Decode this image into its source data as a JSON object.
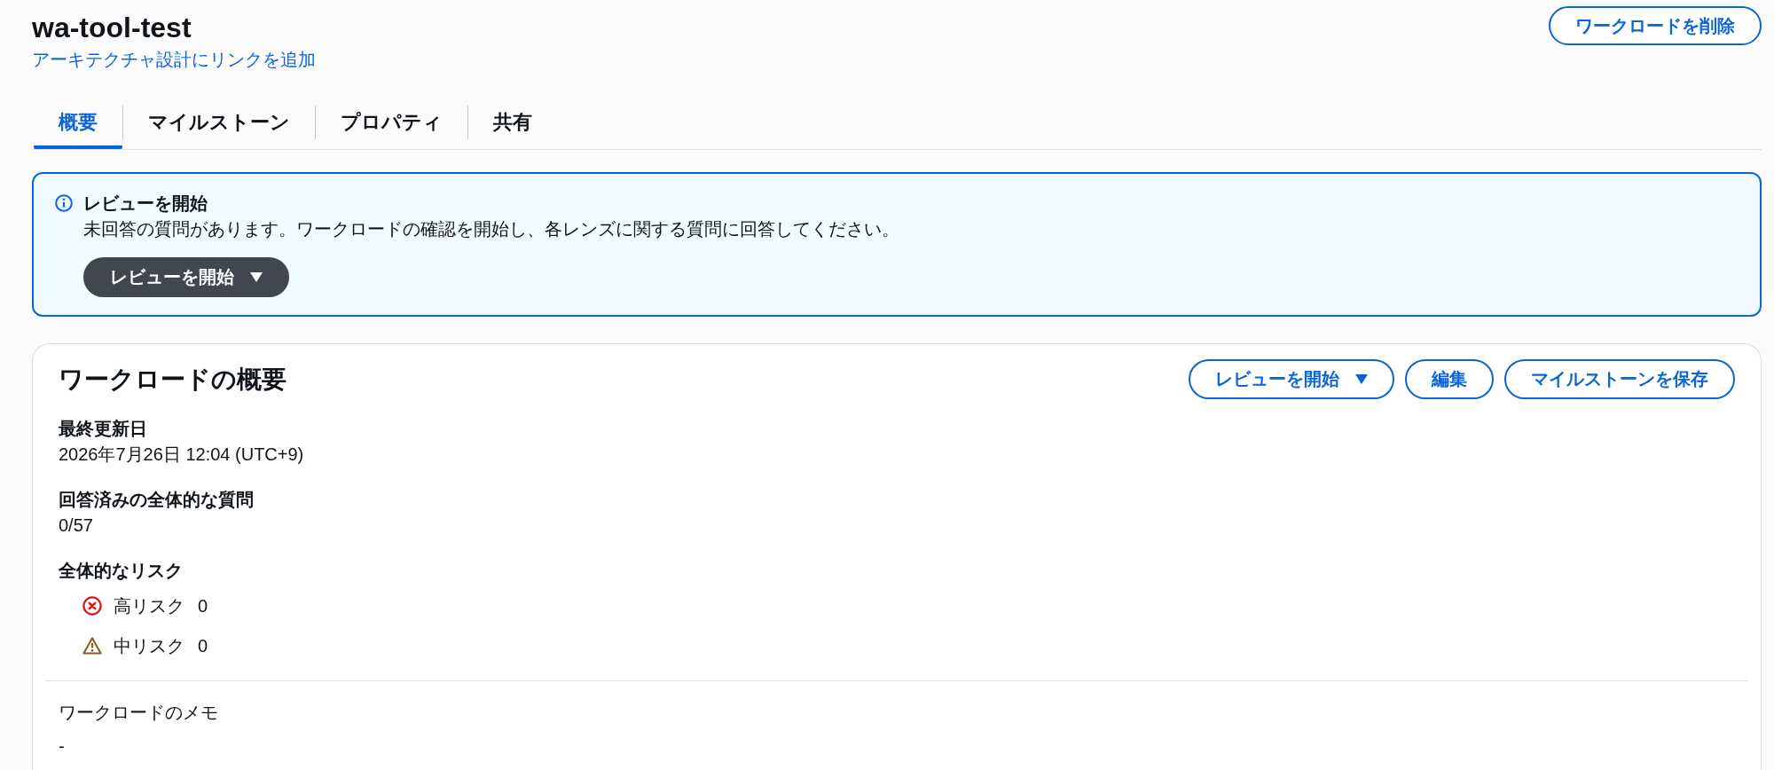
{
  "header": {
    "title": "wa-tool-test",
    "link": "アーキテクチャ設計にリンクを追加",
    "delete_button": "ワークロードを削除"
  },
  "tabs": [
    {
      "label": "概要",
      "selected": true
    },
    {
      "label": "マイルストーン",
      "selected": false
    },
    {
      "label": "プロパティ",
      "selected": false
    },
    {
      "label": "共有",
      "selected": false
    }
  ],
  "alert": {
    "title": "レビューを開始",
    "message": "未回答の質問があります。ワークロードの確認を開始し、各レンズに関する質問に回答してください。",
    "button": {
      "label": "レビューを開始",
      "kind": "dropdown"
    }
  },
  "card": {
    "title": "ワークロードの概要",
    "buttons": [
      {
        "label": "レビューを開始",
        "kind": "dropdown"
      },
      {
        "label": "編集",
        "kind": "normal"
      },
      {
        "label": "マイルストーンを保存",
        "kind": "normal"
      }
    ],
    "fields": [
      {
        "label": "最終更新日",
        "value": "2026年7月26日 12:04 (UTC+9)"
      },
      {
        "label": "回答済みの全体的な質問",
        "value": "0/57"
      }
    ],
    "risk": {
      "label": "全体的なリスク",
      "items": [
        {
          "kind": "high",
          "label": "高リスク",
          "count": "0"
        },
        {
          "kind": "medium",
          "label": "中リスク",
          "count": "0"
        }
      ]
    },
    "notes": {
      "label": "ワークロードのメモ",
      "value": "-"
    }
  }
}
